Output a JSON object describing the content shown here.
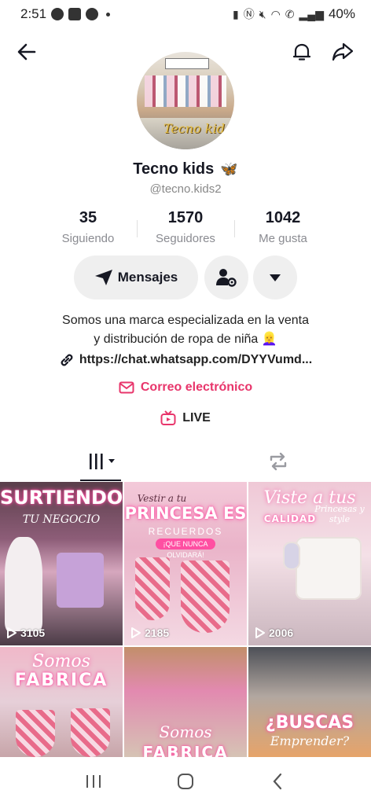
{
  "status_bar": {
    "time": "2:51",
    "battery": "40%"
  },
  "profile": {
    "display_name": "Tecno kids",
    "name_emoji": "🦋",
    "username": "@tecno.kids2",
    "avatar_logo_text": "Tecno kids"
  },
  "stats": [
    {
      "value": "35",
      "label": "Siguiendo"
    },
    {
      "value": "1570",
      "label": "Seguidores"
    },
    {
      "value": "1042",
      "label": "Me gusta"
    }
  ],
  "actions": {
    "message_label": "Mensajes"
  },
  "bio": {
    "line1": "Somos una marca especializada en la venta",
    "line2": "y distribución de ropa de niña",
    "emoji": "👱‍♀️",
    "link": "https://chat.whatsapp.com/DYYVumd...",
    "email_label": "Correo electrónico",
    "live_label": "LIVE"
  },
  "videos": [
    {
      "title": "SURTIENDO",
      "subtitle": "TU NEGOCIO",
      "views": "3105"
    },
    {
      "top_text": "Vestir a tu",
      "title": "PRINCESA ES",
      "subtitle": "RECUERDOS",
      "pill": "¡QUE NUNCA OLVIDARÁ!",
      "views": "2185"
    },
    {
      "title": "Viste a tus",
      "subtitle": "CALIDAD",
      "script": "Princesas y style",
      "views": "2006"
    },
    {
      "top_text": "Somos",
      "title": "FABRICA"
    },
    {
      "top_text": "Somos",
      "title": "FABRICA"
    },
    {
      "title": "¿BUSCAS",
      "script": "Emprender?"
    }
  ],
  "colors": {
    "accent": "#e8356b",
    "neon_pink": "#ff4fa2"
  }
}
